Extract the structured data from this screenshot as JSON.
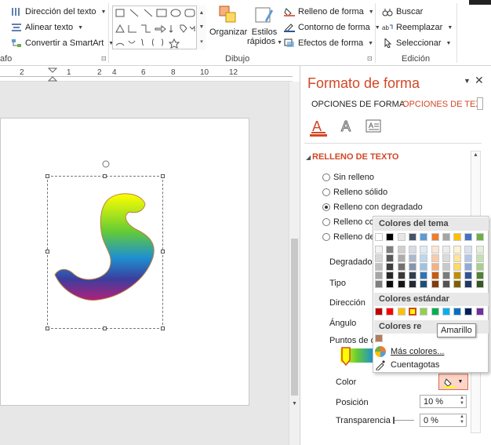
{
  "ribbon": {
    "text_direction": "Dirección del texto",
    "align_text": "Alinear texto",
    "convert_smartart": "Convertir a SmartArt",
    "paragraph_group": "afo",
    "drawing_group": "Dibujo",
    "arrange": "Organizar",
    "quick_styles_1": "Estilos",
    "quick_styles_2": "rápidos",
    "shape_fill": "Relleno de forma",
    "shape_outline": "Contorno de forma",
    "shape_effects": "Efectos de forma",
    "find": "Buscar",
    "replace": "Reemplazar",
    "select": "Seleccionar",
    "editing_group": "Edición"
  },
  "ruler": {
    "ticks": [
      "2",
      "1",
      "2",
      "4",
      "6",
      "8",
      "10",
      "12"
    ]
  },
  "pane": {
    "title": "Formato de forma",
    "tab_shape": "OPCIONES DE FORMA",
    "tab_text": "OPCIONES DE TEX",
    "section": "RELLENO DE TEXTO",
    "fill_options": [
      {
        "label": "Sin relleno",
        "selected": false
      },
      {
        "label": "Relleno sólido",
        "selected": false
      },
      {
        "label": "Relleno con degradado",
        "selected": true
      },
      {
        "label": "Relleno co",
        "selected": false
      },
      {
        "label": "Relleno de",
        "selected": false
      }
    ],
    "preset": "Degradados",
    "type": "Tipo",
    "direction": "Dirección",
    "angle": "Ángulo",
    "stops": "Puntos de d",
    "color": "Color",
    "position": "Posición",
    "position_value": "10 %",
    "transparency": "Transparencia",
    "transparency_value": "0 %"
  },
  "color_menu": {
    "theme_header": "Colores del tema",
    "standard_header": "Colores estándar",
    "recent_header": "Colores re",
    "tooltip": "Amarillo",
    "more_colors": "Más colores...",
    "eyedropper": "Cuentagotas",
    "theme_top": [
      "#ffffff",
      "#000000",
      "#e7e6e6",
      "#44546a",
      "#5b9bd5",
      "#ed7d31",
      "#a5a5a5",
      "#ffc000",
      "#4472c4",
      "#70ad47"
    ],
    "theme_shades": [
      [
        "#f2f2f2",
        "#7f7f7f",
        "#d0cece",
        "#d6dce4",
        "#deebf6",
        "#fbe5d5",
        "#ededed",
        "#fff2cc",
        "#d9e2f3",
        "#e2efd9"
      ],
      [
        "#d8d8d8",
        "#595959",
        "#aeabab",
        "#adb9ca",
        "#bdd7ee",
        "#f7cbac",
        "#dbdbdb",
        "#fee599",
        "#b4c6e7",
        "#c5e0b3"
      ],
      [
        "#bfbfbf",
        "#3f3f3f",
        "#757070",
        "#8496b0",
        "#9cc3e5",
        "#f4b183",
        "#c9c9c9",
        "#ffd965",
        "#8eaadb",
        "#a8d08d"
      ],
      [
        "#a5a5a5",
        "#262626",
        "#3a3838",
        "#323f4f",
        "#2e75b5",
        "#c55a11",
        "#7b7b7b",
        "#bf8f00",
        "#2f5496",
        "#538135"
      ],
      [
        "#7f7f7f",
        "#0c0c0c",
        "#171616",
        "#222a35",
        "#1e4e79",
        "#833c0b",
        "#525252",
        "#7f6000",
        "#1f3864",
        "#375623"
      ]
    ],
    "standard": [
      "#c00000",
      "#ff0000",
      "#ffc000",
      "#ffff00",
      "#92d050",
      "#00b050",
      "#00b0f0",
      "#0070c0",
      "#002060",
      "#7030a0"
    ],
    "recent": [
      "#b87a5a"
    ]
  }
}
